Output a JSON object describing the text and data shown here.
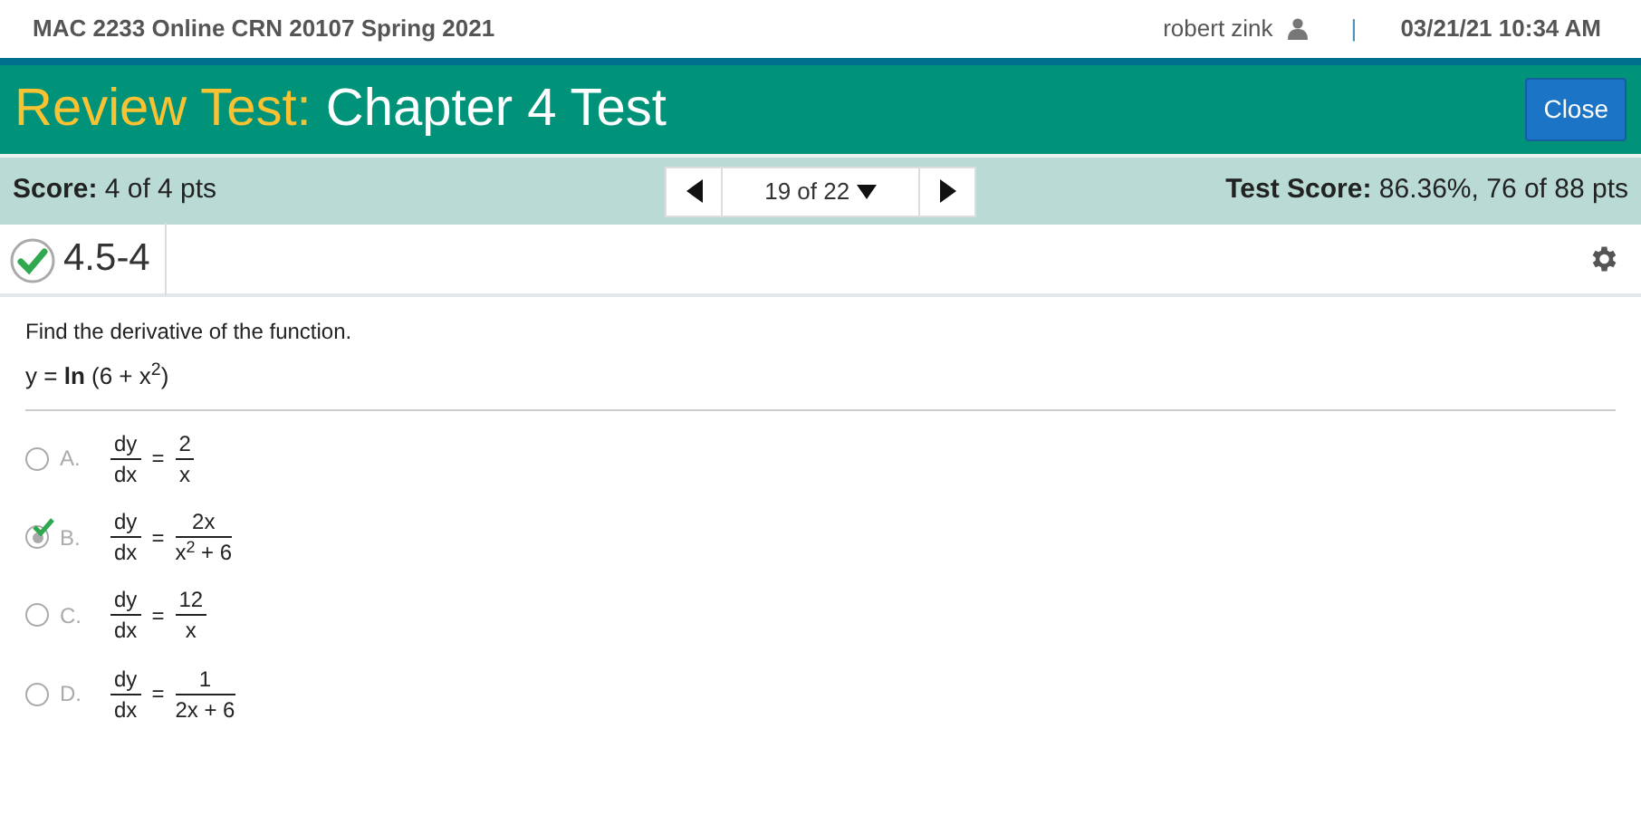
{
  "header": {
    "course": "MAC 2233 Online CRN 20107 Spring 2021",
    "user": "robert zink",
    "separator": "|",
    "datetime": "03/21/21 10:34 AM"
  },
  "title_bar": {
    "prefix": "Review Test:",
    "title": "Chapter 4 Test",
    "close_button": "Close"
  },
  "score_bar": {
    "score_label": "Score:",
    "score": "4 of 4 pts",
    "pager": "19 of 22",
    "test_score_label": "Test Score:",
    "test_score": "86.36%, 76 of 88 pts"
  },
  "question": {
    "number": "4.5-4",
    "correct": true,
    "prompt": "Find the derivative of the function.",
    "function": "y = **ln** (6 + x$^{2}$)"
  },
  "choices": [
    {
      "letter": "A.",
      "numerator": "dy",
      "denominator": "dx",
      "equals": "=",
      "rhs_numerator": "2",
      "rhs_denominator": "x",
      "selected": false,
      "correct": false
    },
    {
      "letter": "B.",
      "numerator": "dy",
      "denominator": "dx",
      "equals": "=",
      "rhs_numerator": "2x",
      "rhs_denominator": "x$^{2}$ + 6",
      "selected": true,
      "correct": true
    },
    {
      "letter": "C.",
      "numerator": "dy",
      "denominator": "dx",
      "equals": "=",
      "rhs_numerator": "12",
      "rhs_denominator": "x",
      "selected": false,
      "correct": false
    },
    {
      "letter": "D.",
      "numerator": "dy",
      "denominator": "dx",
      "equals": "=",
      "rhs_numerator": "1",
      "rhs_denominator": "2x + 6",
      "selected": false,
      "correct": false
    }
  ]
}
